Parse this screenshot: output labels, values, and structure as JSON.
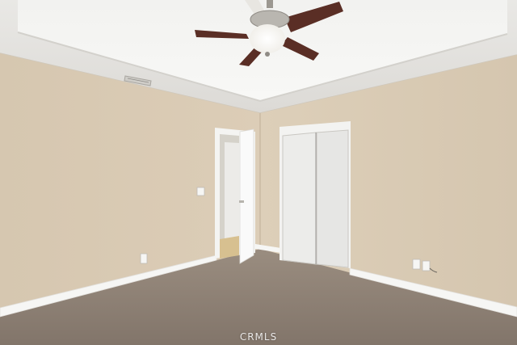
{
  "watermark": {
    "text": "CRMLS"
  },
  "colors": {
    "wall_left": "#d8c9b2",
    "wall_right": "#dccdb6",
    "ceiling": "#ecebe8",
    "tray": "#f5f5f3",
    "carpet": "#8c7e72",
    "trim": "#f7f7f5",
    "closet_door": "#ececea",
    "fan_blade": "#5a2e25"
  }
}
